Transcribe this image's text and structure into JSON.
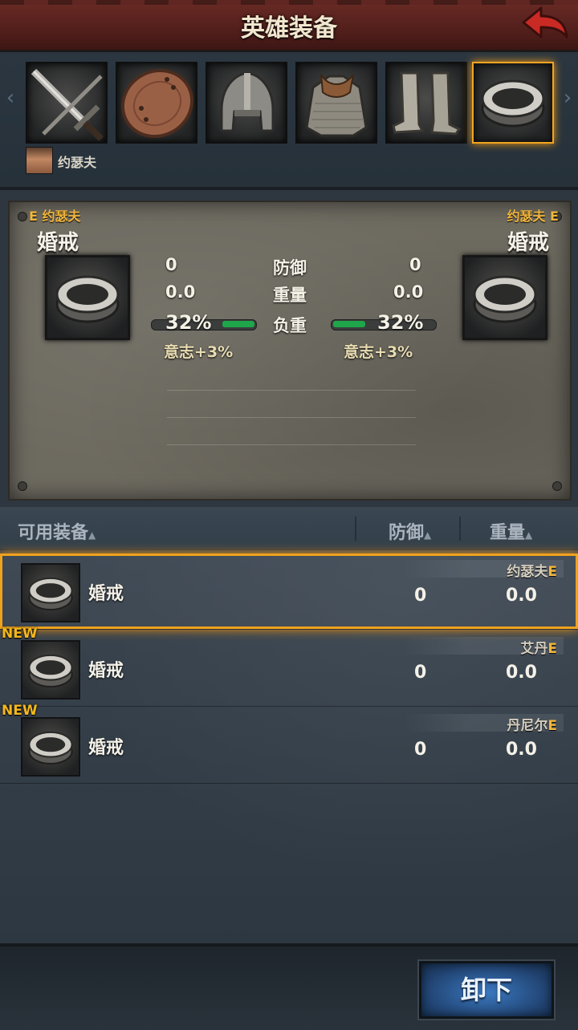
{
  "header": {
    "title": "英雄装备"
  },
  "slots": [
    {
      "name": "sword-slot",
      "icon": "sword-icon"
    },
    {
      "name": "shield-slot",
      "icon": "shield-icon"
    },
    {
      "name": "helmet-slot",
      "icon": "helmet-icon"
    },
    {
      "name": "armor-slot",
      "icon": "chainmail-icon"
    },
    {
      "name": "boots-slot",
      "icon": "boots-icon"
    },
    {
      "name": "ring-slot",
      "icon": "ring-icon",
      "selected": true
    }
  ],
  "hero": {
    "name": "约瑟夫"
  },
  "compare": {
    "left": {
      "owner": "E 约瑟夫",
      "item": "婚戒",
      "defense": "0",
      "weight": "0.0",
      "load": "32%",
      "load_fraction": 0.32,
      "bonus": "意志+3%"
    },
    "right": {
      "owner": "约瑟夫 E",
      "item": "婚戒",
      "defense": "0",
      "weight": "0.0",
      "load": "32%",
      "load_fraction": 0.32,
      "bonus": "意志+3%"
    },
    "labels": {
      "defense": "防御",
      "weight": "重量",
      "load": "负重"
    }
  },
  "list": {
    "headers": {
      "available": "可用装备",
      "defense": "防御",
      "weight": "重量"
    },
    "sort_glyph": "▲",
    "rows": [
      {
        "name": "婚戒",
        "owner": "约瑟夫",
        "defense": "0",
        "weight": "0.0",
        "new": false,
        "selected": true
      },
      {
        "name": "婚戒",
        "owner": "艾丹",
        "defense": "0",
        "weight": "0.0",
        "new": true,
        "selected": false
      },
      {
        "name": "婚戒",
        "owner": "丹尼尔",
        "defense": "0",
        "weight": "0.0",
        "new": true,
        "selected": false
      }
    ],
    "new_label": "NEW",
    "equip_marker": "E"
  },
  "footer": {
    "unequip_label": "卸下"
  },
  "colors": {
    "accent": "#f3a521",
    "header_red": "#6b2b25",
    "button_blue": "#3a78c0",
    "load_green": "#1fa64a"
  }
}
